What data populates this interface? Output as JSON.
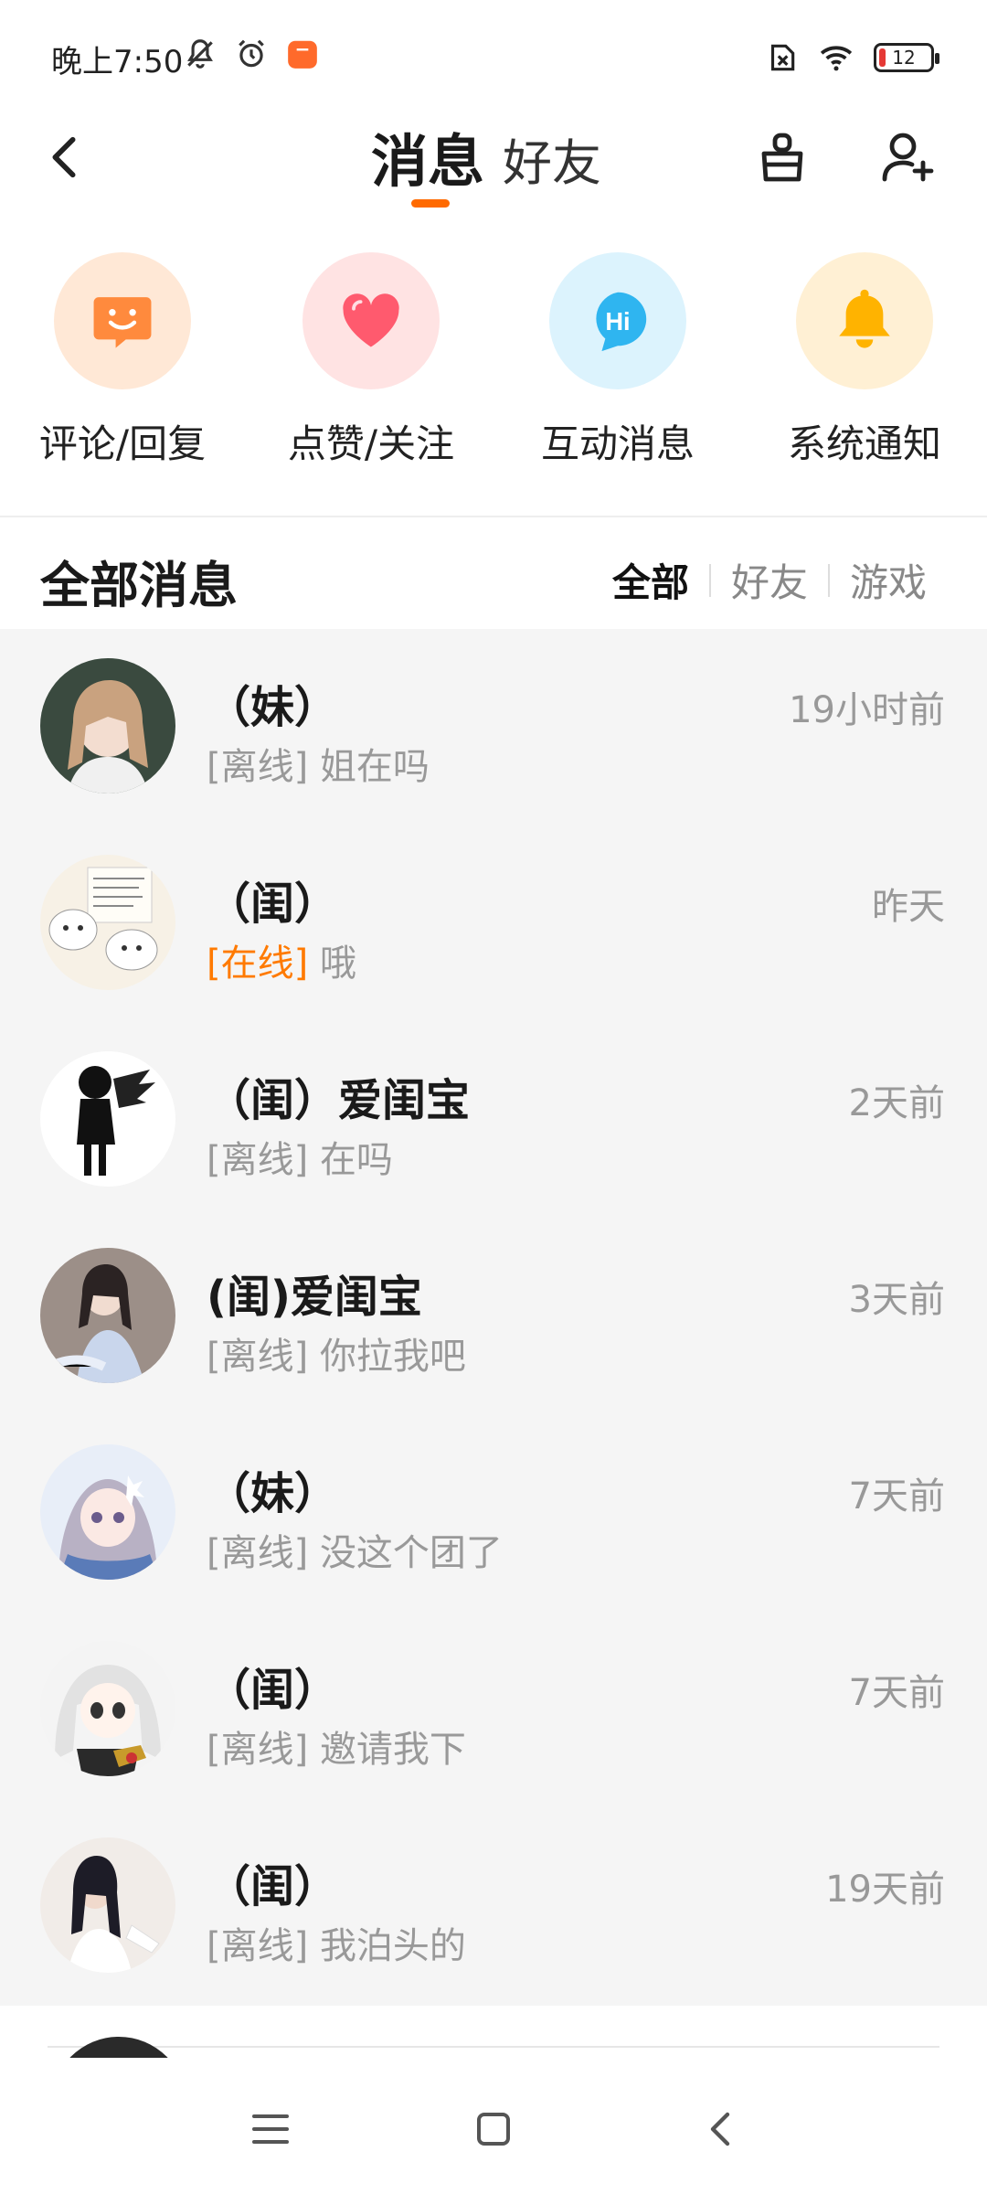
{
  "status_bar": {
    "time": "晚上7:50",
    "battery_level": "12",
    "icons": [
      "mute-bell-icon",
      "alarm-icon",
      "app-notification-icon",
      "sim-off-icon",
      "wifi-icon",
      "battery-icon"
    ]
  },
  "header": {
    "tab_messages": "消息",
    "tab_friends": "好友",
    "active_tab": "消息",
    "accent_color": "#ff6a00",
    "icons": [
      "back-icon",
      "clean-brush-icon",
      "add-friend-icon"
    ]
  },
  "quick_entries": [
    {
      "label": "评论/回复",
      "icon": "comment-smile-icon",
      "bg": "#ffe8d6",
      "color": "#ff8a3d"
    },
    {
      "label": "点赞/关注",
      "icon": "heart-icon",
      "bg": "#ffe3e3",
      "color": "#ff5a6e"
    },
    {
      "label": "互动消息",
      "icon": "hi-bubble-icon",
      "bg": "#dcf3fd",
      "color": "#2fb5f0"
    },
    {
      "label": "系统通知",
      "icon": "bell-icon",
      "bg": "#fff0d4",
      "color": "#ffb300"
    }
  ],
  "section": {
    "title": "全部消息",
    "filters": [
      "全部",
      "好友",
      "游戏"
    ],
    "active_filter": "全部"
  },
  "messages": [
    {
      "name": "（妹）",
      "status": "[离线]",
      "online": false,
      "text": "姐在吗",
      "time": "19小时前"
    },
    {
      "name": "（闺）",
      "status": "[在线]",
      "online": true,
      "text": "哦",
      "time": "昨天"
    },
    {
      "name": "（闺）爱闺宝",
      "status": "[离线]",
      "online": false,
      "text": "在吗",
      "time": "2天前"
    },
    {
      "name": "(闺)爱闺宝",
      "status": "[离线]",
      "online": false,
      "text": "你拉我吧",
      "time": "3天前"
    },
    {
      "name": "（妹）",
      "status": "[离线]",
      "online": false,
      "text": "没这个团了",
      "time": "7天前"
    },
    {
      "name": "（闺）",
      "status": "[离线]",
      "online": false,
      "text": "邀请我下",
      "time": "7天前"
    },
    {
      "name": "（闺）",
      "status": "[离线]",
      "online": false,
      "text": "我泊头的",
      "time": "19天前"
    }
  ],
  "navbar": {
    "icons": [
      "menu-icon",
      "home-icon",
      "back-nav-icon"
    ]
  }
}
